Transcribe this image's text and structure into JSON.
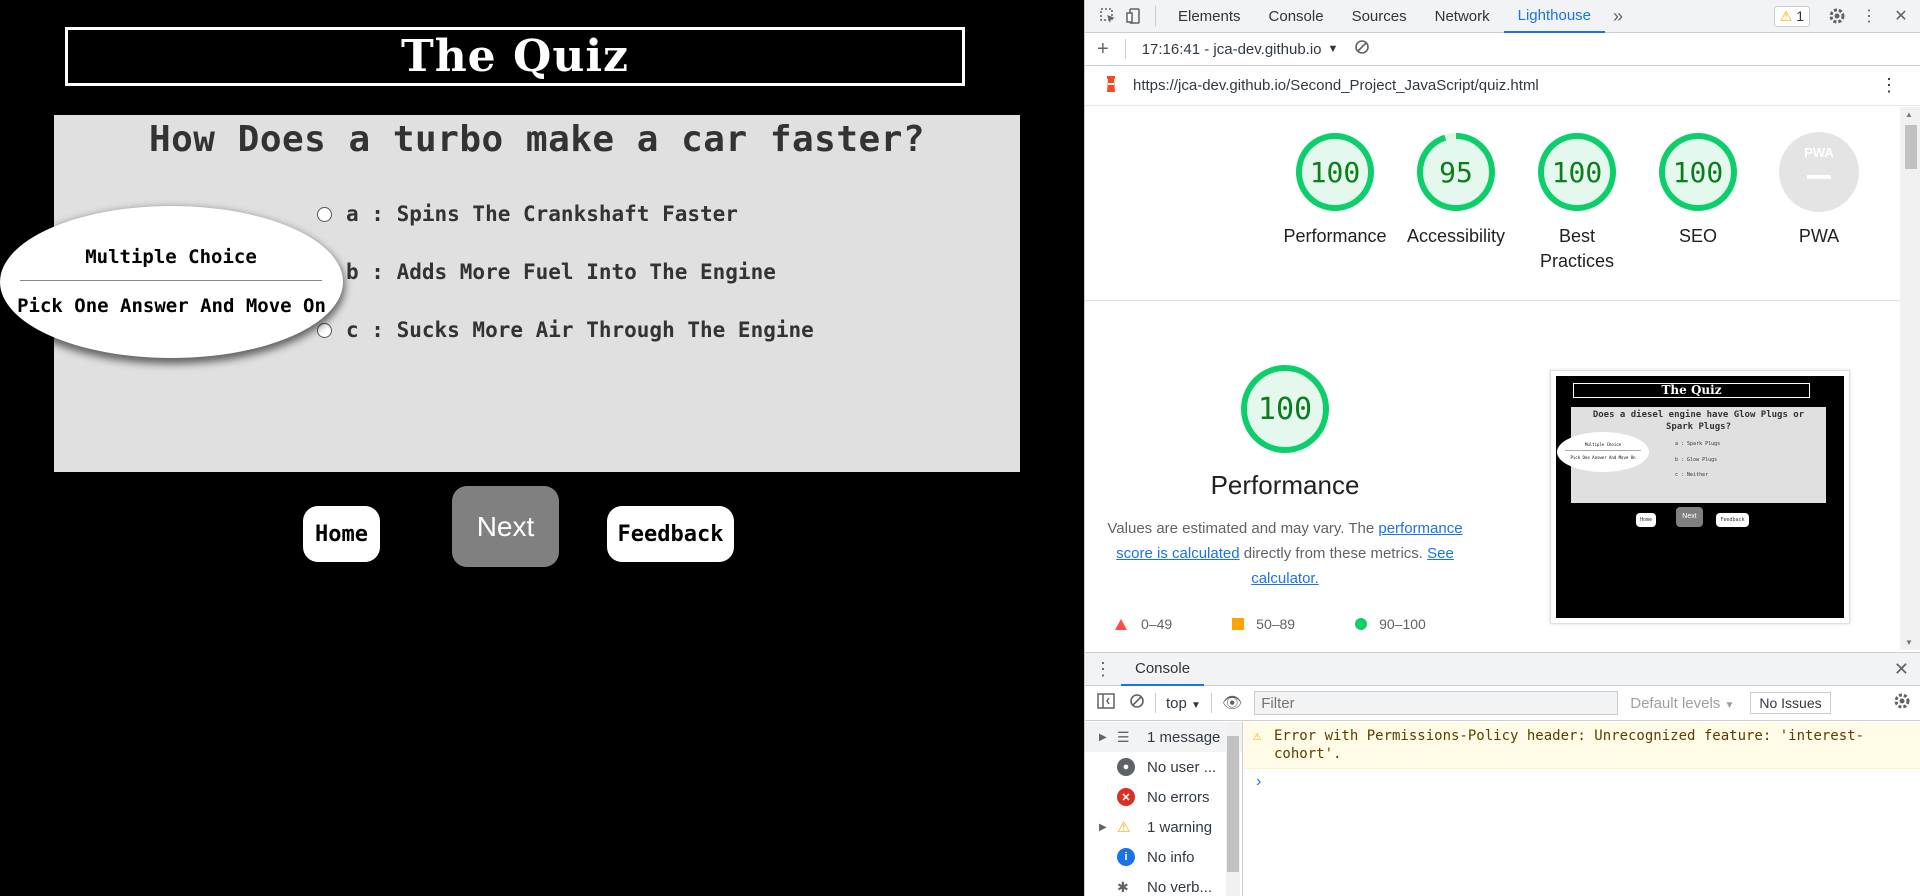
{
  "quiz": {
    "title": "The Quiz",
    "question": "How Does a turbo make a car faster?",
    "answers": [
      {
        "label": "a : Spins The Crankshaft Faster"
      },
      {
        "label": "b : Adds More Fuel Into The Engine"
      },
      {
        "label": "c : Sucks More Air Through The Engine"
      }
    ],
    "instructions": {
      "title": "Multiple Choice",
      "subtitle": "Pick One Answer And Move On"
    },
    "buttons": {
      "home": "Home",
      "next": "Next",
      "feedback": "Feedback"
    }
  },
  "devtools": {
    "tabs": [
      "Elements",
      "Console",
      "Sources",
      "Network",
      "Lighthouse"
    ],
    "active_tab": "Lighthouse",
    "more_tabs_icon": "chevron-double-right-icon",
    "warning_count": "1",
    "report_time": "17:16:41 - jca-dev.github.io",
    "url": "https://jca-dev.github.io/Second_Project_JavaScript/quiz.html",
    "scores": [
      {
        "label": "Performance",
        "value": "100",
        "score": 100
      },
      {
        "label": "Accessibility",
        "value": "95",
        "score": 95
      },
      {
        "label": "Best Practices",
        "value": "100",
        "score": 100
      },
      {
        "label": "SEO",
        "value": "100",
        "score": 100
      },
      {
        "label": "PWA",
        "value": "PWA",
        "score": null
      }
    ],
    "performance": {
      "value": "100",
      "title": "Performance",
      "desc_prefix": "Values are estimated and may vary. The ",
      "desc_link1": "performance score is calculated",
      "desc_mid": " directly from these metrics. ",
      "desc_link2": "See calculator.",
      "legend": [
        "0–49",
        "50–89",
        "90–100"
      ]
    },
    "screenshot": {
      "title": "The Quiz",
      "question": "Does a diesel engine have Glow Plugs or Spark Plugs?",
      "answers": [
        "a : Spark Plugs",
        "b : Glow Plugs",
        "c : Neither"
      ],
      "ellipse_title": "Multiple Choice",
      "ellipse_sub": "Pick One Answer And Move On",
      "buttons": [
        "Home",
        "Next",
        "Feedback"
      ]
    },
    "console": {
      "tab_label": "Console",
      "context": "top",
      "filter_placeholder": "Filter",
      "levels": "Default levels",
      "issues": "No Issues",
      "sidebar": [
        {
          "label": "1 message",
          "icon": "list-icon"
        },
        {
          "label": "No user ...",
          "icon": "user-icon"
        },
        {
          "label": "No errors",
          "icon": "error-icon"
        },
        {
          "label": "1 warning",
          "icon": "warning-icon"
        },
        {
          "label": "No info",
          "icon": "info-icon"
        },
        {
          "label": "No verb...",
          "icon": "verbose-icon"
        }
      ],
      "message": "Error with Permissions-Policy header: Unrecognized feature: 'interest-cohort'.",
      "prompt": "›"
    }
  },
  "colors": {
    "pass_green": "#0cce6b",
    "pass_text": "#0c7d1d",
    "fail_red": "#ff4e42",
    "average_orange": "#ffa400",
    "link_blue": "#1a73e8",
    "panel_grey": "#e0e0e0"
  }
}
